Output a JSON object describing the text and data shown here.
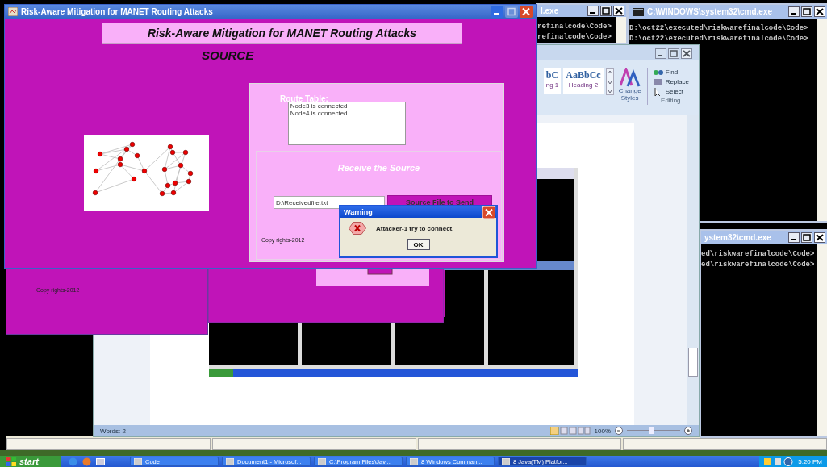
{
  "java_window": {
    "title": "Risk-Aware Mitigation for MANET Routing Attacks",
    "header": "Risk-Aware Mitigation for MANET Routing Attacks",
    "subtitle": "SOURCE",
    "route_table": {
      "label": "Route Table:",
      "entries": [
        "Node3 is connected",
        "Node4 is connected"
      ]
    },
    "receive_panel": {
      "title": "Receive the Source",
      "file_field": {
        "value": "D:\\Receivedfile.txt"
      },
      "send_button": "Source File to Send",
      "copyright": "Copy rights-2012"
    }
  },
  "warning_dialog": {
    "title": "Warning",
    "message": "Attacker-1  try to connect.",
    "ok_button": "OK"
  },
  "stale_frame": {
    "copyright": "Copy rights-2012"
  },
  "cmd_windows": [
    {
      "title": "l.exe",
      "lines": [
        "refinalcode\\Code>",
        "refinalcode\\Code>"
      ]
    },
    {
      "title": "C:\\WINDOWS\\system32\\cmd.exe",
      "lines": [
        "D:\\oct22\\executed\\riskwarefinalcode\\Code>",
        "D:\\oct22\\executed\\riskwarefinalcode\\Code>"
      ]
    },
    {
      "title": "ystem32\\cmd.exe",
      "lines": [
        "ed\\riskwarefinalcode\\Code>",
        "ed\\riskwarefinalcode\\Code>"
      ]
    }
  ],
  "word_window": {
    "ribbon": {
      "styles": [
        {
          "preview": "bC",
          "name": "ng 1"
        },
        {
          "preview": "AaBbCc",
          "name": "Heading 2"
        }
      ],
      "change_styles": "Change Styles",
      "editing": [
        "Find",
        "Replace",
        "Select"
      ],
      "group_label": "Editing"
    },
    "status_bar": {
      "words": "Words: 2",
      "zoom": "100%",
      "zoom_slider": {
        "level": 0.5
      }
    }
  },
  "taskbar": {
    "start": "start",
    "buttons": [
      {
        "label": "Code",
        "selected": false
      },
      {
        "label": "Document1 - Microsof...",
        "selected": false
      },
      {
        "label": "C:\\Program Files\\Jav...",
        "selected": false
      },
      {
        "label": "8 Windows Comman...",
        "selected": false
      },
      {
        "label": "8 Java(TM) Platfor...",
        "selected": true
      }
    ],
    "clock": "5:20 PM"
  }
}
